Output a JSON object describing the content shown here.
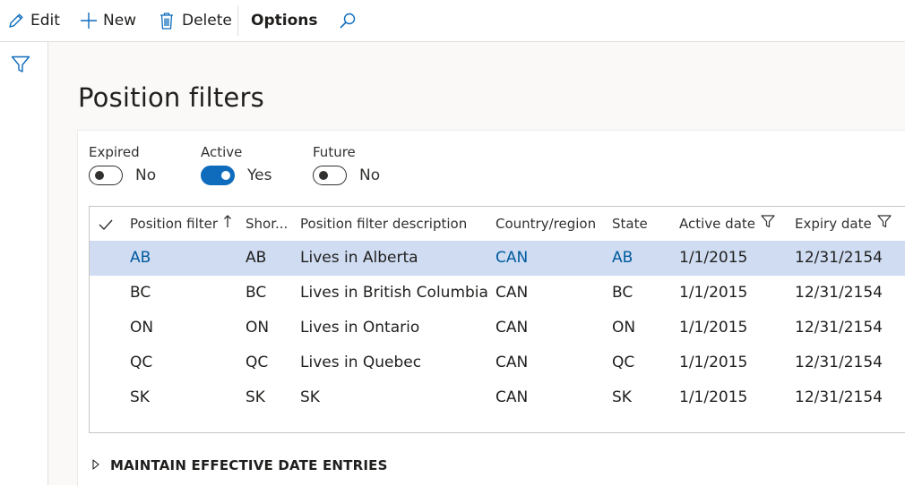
{
  "toolbar": {
    "edit_label": "Edit",
    "new_label": "New",
    "delete_label": "Delete",
    "options_label": "Options",
    "icons": [
      "pencil-icon",
      "plus-icon",
      "trash-icon",
      "search-icon"
    ]
  },
  "rail": {
    "icon": "filter-icon"
  },
  "page": {
    "title": "Position filters"
  },
  "toggles": [
    {
      "label": "Expired",
      "value": "No",
      "on": false
    },
    {
      "label": "Active",
      "value": "Yes",
      "on": true
    },
    {
      "label": "Future",
      "value": "No",
      "on": false
    }
  ],
  "grid": {
    "columns": {
      "position_filter": "Position filter",
      "short": "Shor...",
      "description": "Position filter description",
      "country": "Country/region",
      "state": "State",
      "active_date": "Active date",
      "expiry_date": "Expiry date"
    },
    "rows": [
      {
        "position_filter": "AB",
        "short": "AB",
        "description": "Lives in Alberta",
        "country": "CAN",
        "state": "AB",
        "active_date": "1/1/2015",
        "expiry_date": "12/31/2154"
      },
      {
        "position_filter": "BC",
        "short": "BC",
        "description": "Lives in British Columbia",
        "country": "CAN",
        "state": "BC",
        "active_date": "1/1/2015",
        "expiry_date": "12/31/2154"
      },
      {
        "position_filter": "ON",
        "short": "ON",
        "description": "Lives in Ontario",
        "country": "CAN",
        "state": "ON",
        "active_date": "1/1/2015",
        "expiry_date": "12/31/2154"
      },
      {
        "position_filter": "QC",
        "short": "QC",
        "description": "Lives in Quebec",
        "country": "CAN",
        "state": "QC",
        "active_date": "1/1/2015",
        "expiry_date": "12/31/2154"
      },
      {
        "position_filter": "SK",
        "short": "SK",
        "description": "SK",
        "country": "CAN",
        "state": "SK",
        "active_date": "1/1/2015",
        "expiry_date": "12/31/2154"
      }
    ],
    "selected_row": 0
  },
  "fasttab": {
    "label": "MAINTAIN EFFECTIVE DATE ENTRIES"
  },
  "colors": {
    "accent": "#0f6cbd",
    "selected_row": "#cfdcf2",
    "link": "#005a9e"
  }
}
